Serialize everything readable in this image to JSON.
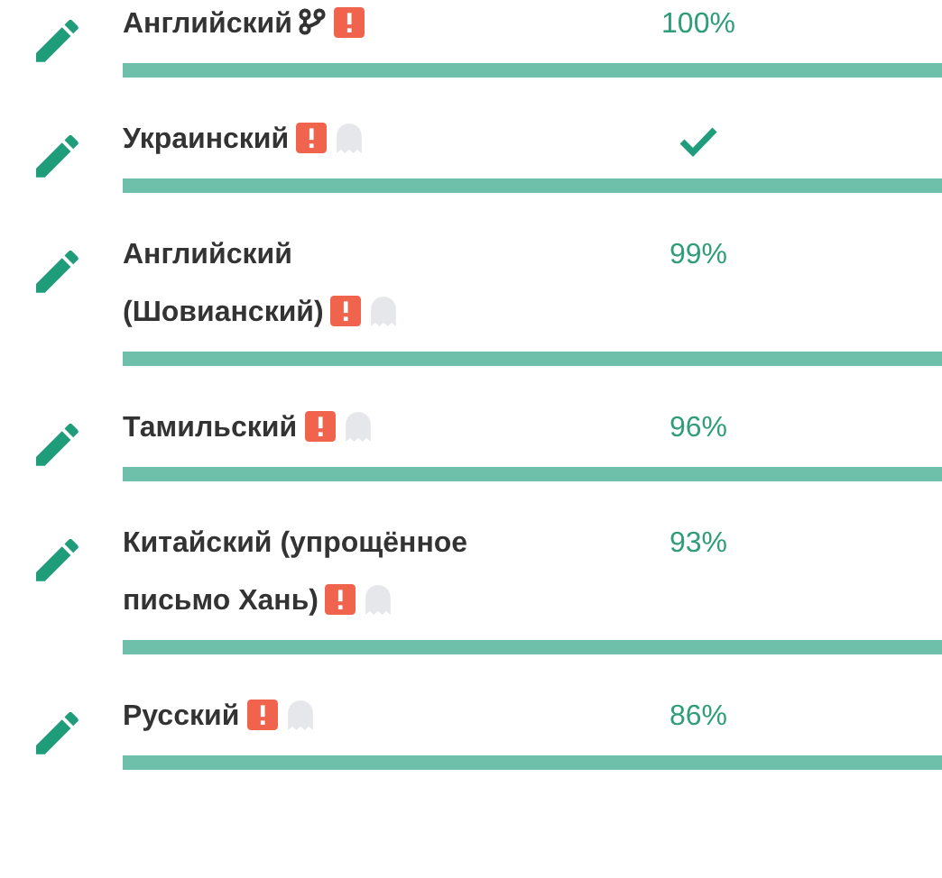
{
  "languages": [
    {
      "name": "Английский",
      "status": {
        "kind": "percent",
        "text": "100%"
      },
      "linked": true,
      "alert": true,
      "ghost": false
    },
    {
      "name": "Украинский",
      "status": {
        "kind": "check"
      },
      "linked": false,
      "alert": true,
      "ghost": true
    },
    {
      "name": "Английский (Шовианский)",
      "status": {
        "kind": "percent",
        "text": "99%"
      },
      "linked": false,
      "alert": true,
      "ghost": true
    },
    {
      "name": "Тамильский",
      "status": {
        "kind": "percent",
        "text": "96%"
      },
      "linked": false,
      "alert": true,
      "ghost": true
    },
    {
      "name": "Китайский (упрощённое письмо Хань)",
      "status": {
        "kind": "percent",
        "text": "93%"
      },
      "linked": false,
      "alert": true,
      "ghost": true
    },
    {
      "name": "Русский",
      "status": {
        "kind": "percent",
        "text": "86%"
      },
      "linked": false,
      "alert": true,
      "ghost": true
    }
  ]
}
